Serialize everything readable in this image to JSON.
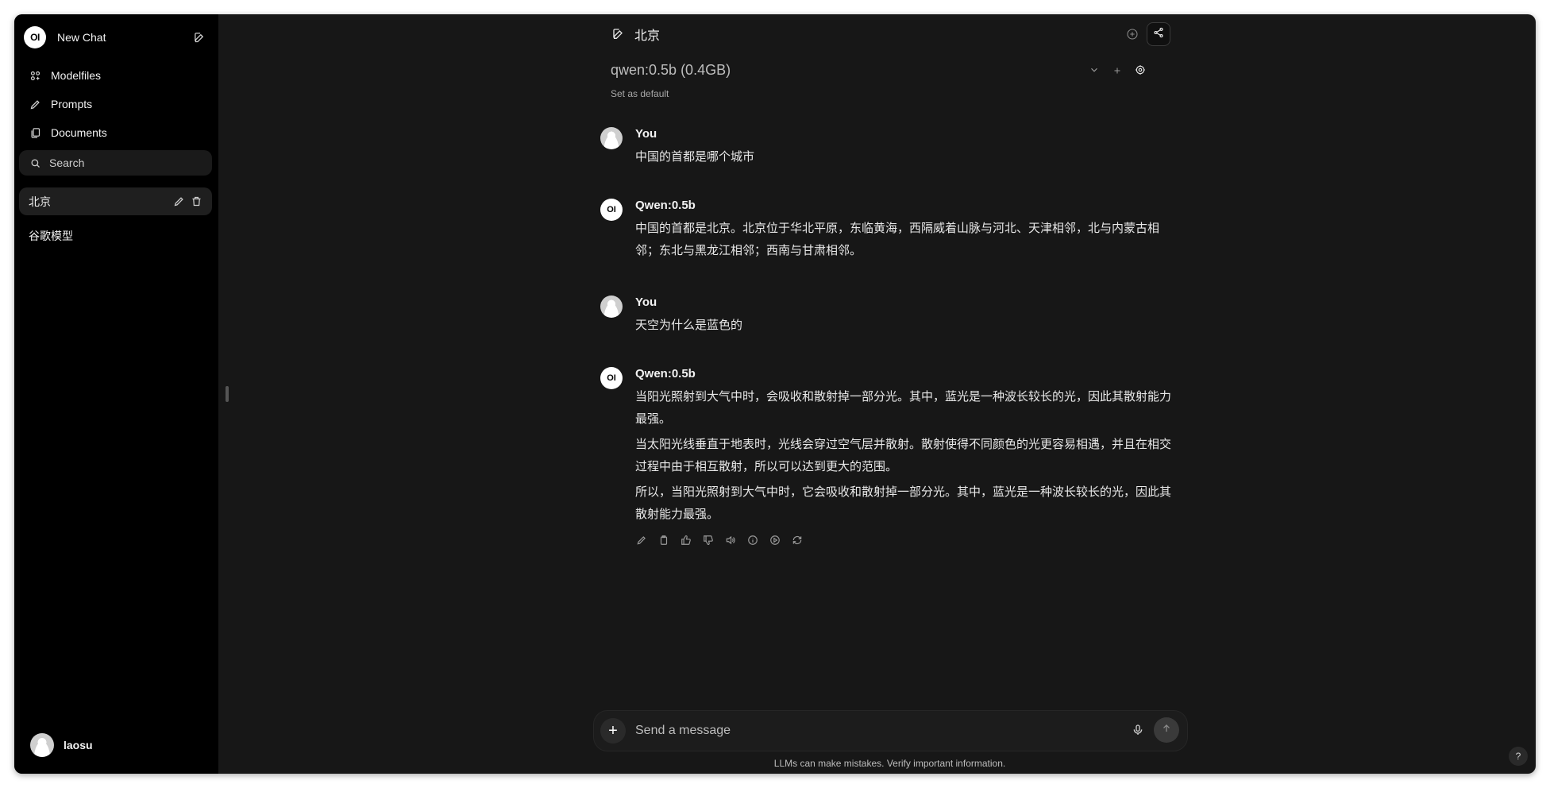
{
  "sidebar": {
    "new_chat_label": "New Chat",
    "logo_text": "OI",
    "nav": [
      {
        "label": "Modelfiles"
      },
      {
        "label": "Prompts"
      },
      {
        "label": "Documents"
      }
    ],
    "search_placeholder": "Search",
    "chats": [
      {
        "title": "北京"
      },
      {
        "title": "谷歌模型"
      }
    ],
    "user_name": "laosu"
  },
  "header": {
    "chat_title": "北京",
    "model": "qwen:0.5b (0.4GB)",
    "set_default_label": "Set as default"
  },
  "messages": [
    {
      "role": "user",
      "name": "You",
      "paragraphs": [
        "中国的首都是哪个城市"
      ]
    },
    {
      "role": "assistant",
      "name": "Qwen:0.5b",
      "paragraphs": [
        "中国的首都是北京。北京位于华北平原，东临黄海，西隔威着山脉与河北、天津相邻，北与内蒙古相邻；东北与黑龙江相邻；西南与甘肃相邻。"
      ]
    },
    {
      "role": "user",
      "name": "You",
      "paragraphs": [
        "天空为什么是蓝色的"
      ]
    },
    {
      "role": "assistant",
      "name": "Qwen:0.5b",
      "paragraphs": [
        "当阳光照射到大气中时，会吸收和散射掉一部分光。其中，蓝光是一种波长较长的光，因此其散射能力最强。",
        "当太阳光线垂直于地表时，光线会穿过空气层并散射。散射使得不同颜色的光更容易相遇，并且在相交过程中由于相互散射，所以可以达到更大的范围。",
        "所以，当阳光照射到大气中时，它会吸收和散射掉一部分光。其中，蓝光是一种波长较长的光，因此其散射能力最强。"
      ]
    }
  ],
  "composer": {
    "placeholder": "Send a message",
    "disclaimer": "LLMs can make mistakes. Verify important information."
  },
  "help_label": "?"
}
